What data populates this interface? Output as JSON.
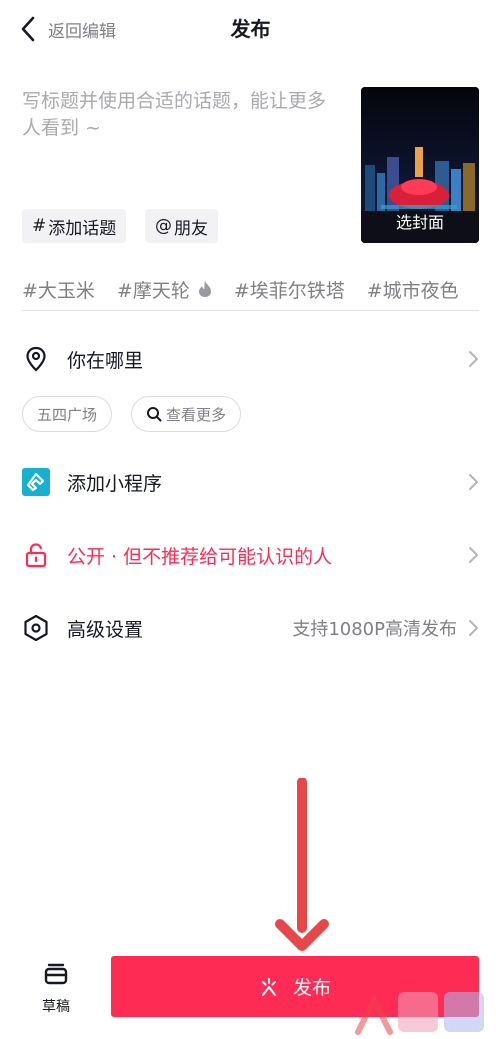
{
  "header": {
    "back_label": "返回编辑",
    "title": "发布"
  },
  "post": {
    "description_placeholder": "写标题并使用合适的话题，能让更多人看到 ~",
    "cover_label": "选封面"
  },
  "chips": {
    "topic_symbol": "#",
    "topic_label": "添加话题",
    "mention_symbol": "@",
    "mention_label": "朋友"
  },
  "suggested_topics": [
    "#大玉米",
    "#摩天轮",
    "#埃菲尔铁塔",
    "#城市夜色"
  ],
  "location": {
    "label": "你在哪里",
    "chips": [
      "五四广场",
      "查看更多"
    ]
  },
  "mini_program": {
    "label": "添加小程序"
  },
  "visibility": {
    "label": "公开 · 但不推荐给可能认识的人"
  },
  "advanced": {
    "label": "高级设置",
    "hint": "支持1080P高清发布"
  },
  "bottom": {
    "drafts_label": "草稿",
    "publish_label": "发布"
  },
  "colors": {
    "accent": "#fe2c55",
    "mini_program_icon": "#17b1cf",
    "annotation_arrow": "#e8474a"
  },
  "icons": [
    "chevron-left-icon",
    "location-pin-icon",
    "mini-program-icon",
    "lock-icon",
    "settings-hex-icon",
    "fire-icon",
    "search-icon",
    "drafts-icon",
    "sparkle-icon",
    "chevron-right-icon"
  ]
}
